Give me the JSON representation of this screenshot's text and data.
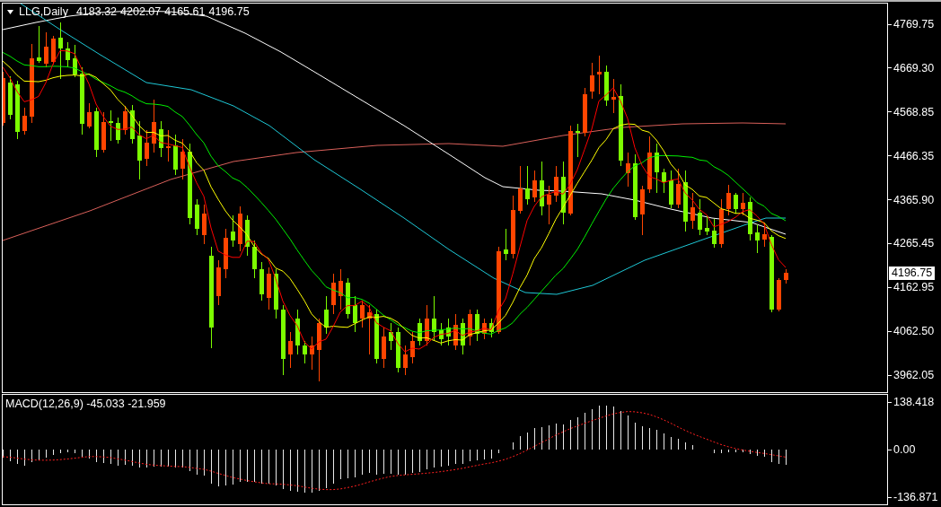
{
  "chart": {
    "symbol": "LLG,Daily",
    "ohlc": [
      "4183.32",
      "4202.07",
      "4165.61",
      "4196.75"
    ],
    "price_axis": [
      "4769.75",
      "4669.30",
      "4568.85",
      "4466.35",
      "4365.90",
      "4265.45",
      "4162.95",
      "4062.50",
      "3962.05"
    ],
    "current_price": "4196.75"
  },
  "macd": {
    "label": "MACD(12,26,9) -45.033 -21.959",
    "axis": [
      "138.418",
      "0.00",
      "-136.871"
    ]
  }
}
